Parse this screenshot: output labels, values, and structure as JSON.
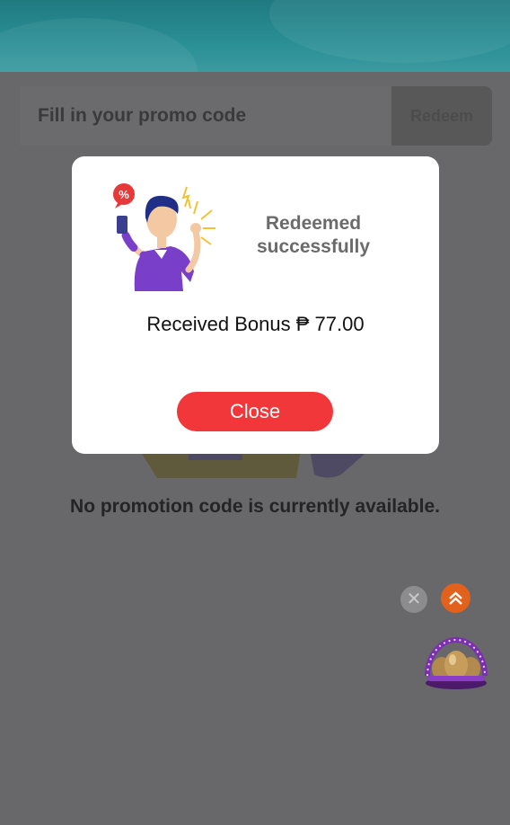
{
  "promo": {
    "placeholder": "Fill in your promo code",
    "redeem_label": "Redeem"
  },
  "empty_state": {
    "message": "No promotion code is currently available."
  },
  "modal": {
    "title": "Redeemed successfully",
    "message": "Received Bonus ₱ 77.00",
    "close_label": "Close"
  },
  "floating": {
    "dismiss_icon": "close-icon",
    "scroll_top_icon": "double-chevron-up-icon",
    "promo_widget_icon": "golden-eggs-icon"
  },
  "colors": {
    "overlay": "#686769",
    "header": "#2a8f95",
    "close_button": "#f1373a",
    "modal_bg": "#ffffff"
  }
}
